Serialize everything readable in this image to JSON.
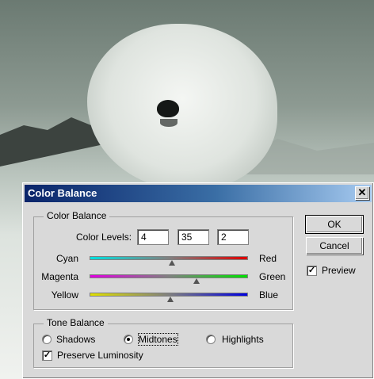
{
  "dialog": {
    "title": "Color Balance",
    "close_glyph": "✕",
    "color_balance_group": {
      "legend": "Color Balance",
      "levels_label": "Color Levels:",
      "levels": [
        "4",
        "35",
        "2"
      ],
      "sliders": [
        {
          "left": "Cyan",
          "right": "Red",
          "value": 4,
          "min": -100,
          "max": 100,
          "left_color": "#00e0e0",
          "right_color": "#e00000"
        },
        {
          "left": "Magenta",
          "right": "Green",
          "value": 35,
          "min": -100,
          "max": 100,
          "left_color": "#e000e0",
          "right_color": "#00e000"
        },
        {
          "left": "Yellow",
          "right": "Blue",
          "value": 2,
          "min": -100,
          "max": 100,
          "left_color": "#e0e000",
          "right_color": "#0000e0"
        }
      ]
    },
    "tone_balance_group": {
      "legend": "Tone Balance",
      "options": [
        {
          "label": "Shadows",
          "selected": false
        },
        {
          "label": "Midtones",
          "selected": true
        },
        {
          "label": "Highlights",
          "selected": false
        }
      ],
      "preserve_luminosity": {
        "label": "Preserve Luminosity",
        "checked": true
      }
    },
    "ok_label": "OK",
    "cancel_label": "Cancel",
    "preview": {
      "label": "Preview",
      "checked": true
    },
    "check_glyph": "✓"
  },
  "colors": {
    "titlebar_start": "#0a246a",
    "titlebar_end": "#a6caf0",
    "dialog_bg": "#d9d9d9"
  }
}
